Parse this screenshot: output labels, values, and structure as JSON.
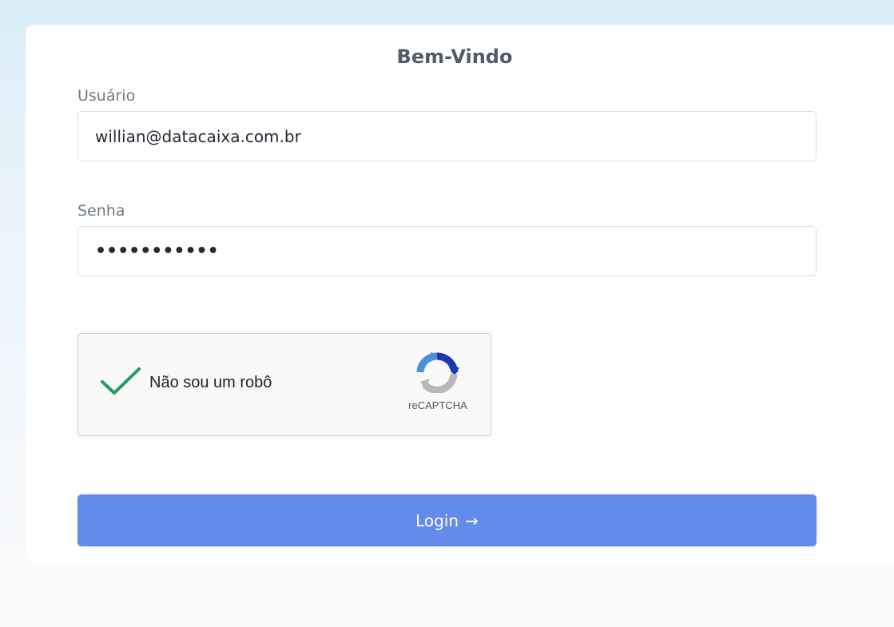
{
  "header": {
    "title": "Bem-Vindo"
  },
  "form": {
    "user_label": "Usuário",
    "user_value": "willian@datacaixa.com.br",
    "password_label": "Senha",
    "password_value": "•••••••••••"
  },
  "recaptcha": {
    "checkbox_label": "Não sou um robô",
    "brand": "reCAPTCHA",
    "checked": true
  },
  "actions": {
    "login_label": "Login",
    "login_icon": "arrow-right-icon"
  },
  "colors": {
    "primary_button": "#638beb",
    "checkmark": "#1e9e5c",
    "title": "#4d5b6b"
  }
}
